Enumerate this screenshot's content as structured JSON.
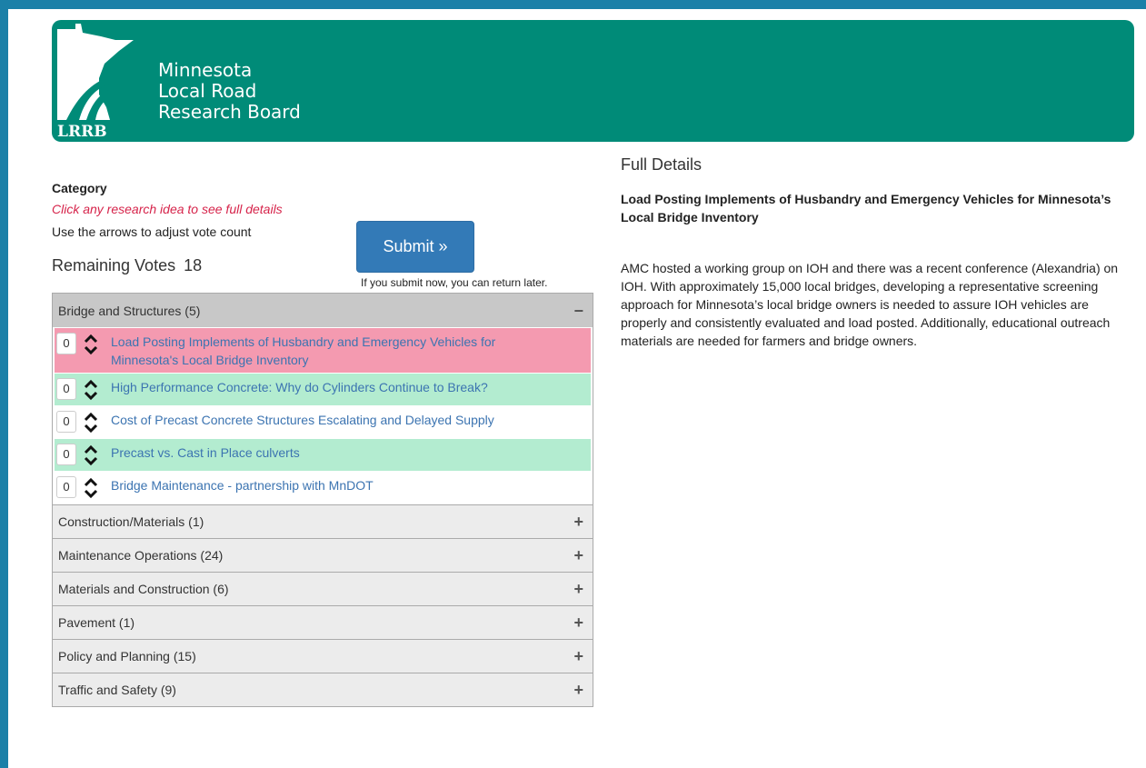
{
  "header": {
    "logo_text": "LRRB",
    "brand_line1": "Minnesota",
    "brand_line2": "Local Road",
    "brand_line3": "Research Board"
  },
  "sidebar": {
    "category_label": "Category",
    "hint_click": "Click any research idea to see full details",
    "hint_arrows": "Use the arrows to adjust vote count",
    "remaining_label": "Remaining Votes",
    "remaining_value": "18",
    "submit_label": "Submit »",
    "submit_note": "If you submit now, you can return later."
  },
  "categories": [
    {
      "label": "Bridge and Structures (5)",
      "sign": "−"
    },
    {
      "label": "Construction/Materials (1)",
      "sign": "+"
    },
    {
      "label": "Maintenance Operations (24)",
      "sign": "+"
    },
    {
      "label": "Materials and Construction (6)",
      "sign": "+"
    },
    {
      "label": "Pavement (1)",
      "sign": "+"
    },
    {
      "label": "Policy and Planning (15)",
      "sign": "+"
    },
    {
      "label": "Traffic and Safety (9)",
      "sign": "+"
    }
  ],
  "items": [
    {
      "count": "0",
      "label": "Load Posting Implements of Husbandry and Emergency Vehicles for Minnesota's Local Bridge Inventory",
      "state": "selected",
      "color": "#f49ab0"
    },
    {
      "count": "0",
      "label": "High Performance Concrete: Why do Cylinders Continue to Break?",
      "state": "voted",
      "color": "#b3ecd0"
    },
    {
      "count": "0",
      "label": "Cost of Precast Concrete Structures Escalating and Delayed Supply",
      "state": "default",
      "color": "#ffffff"
    },
    {
      "count": "0",
      "label": "Precast vs. Cast in Place culverts",
      "state": "voted",
      "color": "#b3ecd0"
    },
    {
      "count": "0",
      "label": "Bridge Maintenance - partnership with MnDOT",
      "state": "default",
      "color": "#ffffff"
    }
  ],
  "details": {
    "title": "Full Details",
    "heading": "Load Posting Implements of Husbandry and Emergency Vehicles for Minnesota’s Local Bridge Inventory",
    "body": "AMC hosted a working group on IOH and there was a recent conference (Alexandria) on IOH. With approximately 15,000 local bridges, developing a representative screening approach for Minnesota’s local bridge owners is needed to assure IOH vehicles are properly and consistently evaluated and load posted. Additionally, educational outreach materials are needed for farmers and bridge owners."
  },
  "icons": {
    "logo": "minnesota-state-road-logo",
    "vote_arrows": "up-down-chevron-icon",
    "collapse": "minus-icon",
    "expand": "plus-icon"
  },
  "colors": {
    "frame": "#1b80a8",
    "header": "#008b78",
    "submit": "#337ab7",
    "selected_row": "#f49ab0",
    "voted_row": "#b3ecd0",
    "link": "#3c74b1",
    "hint_red": "#d6234a"
  }
}
